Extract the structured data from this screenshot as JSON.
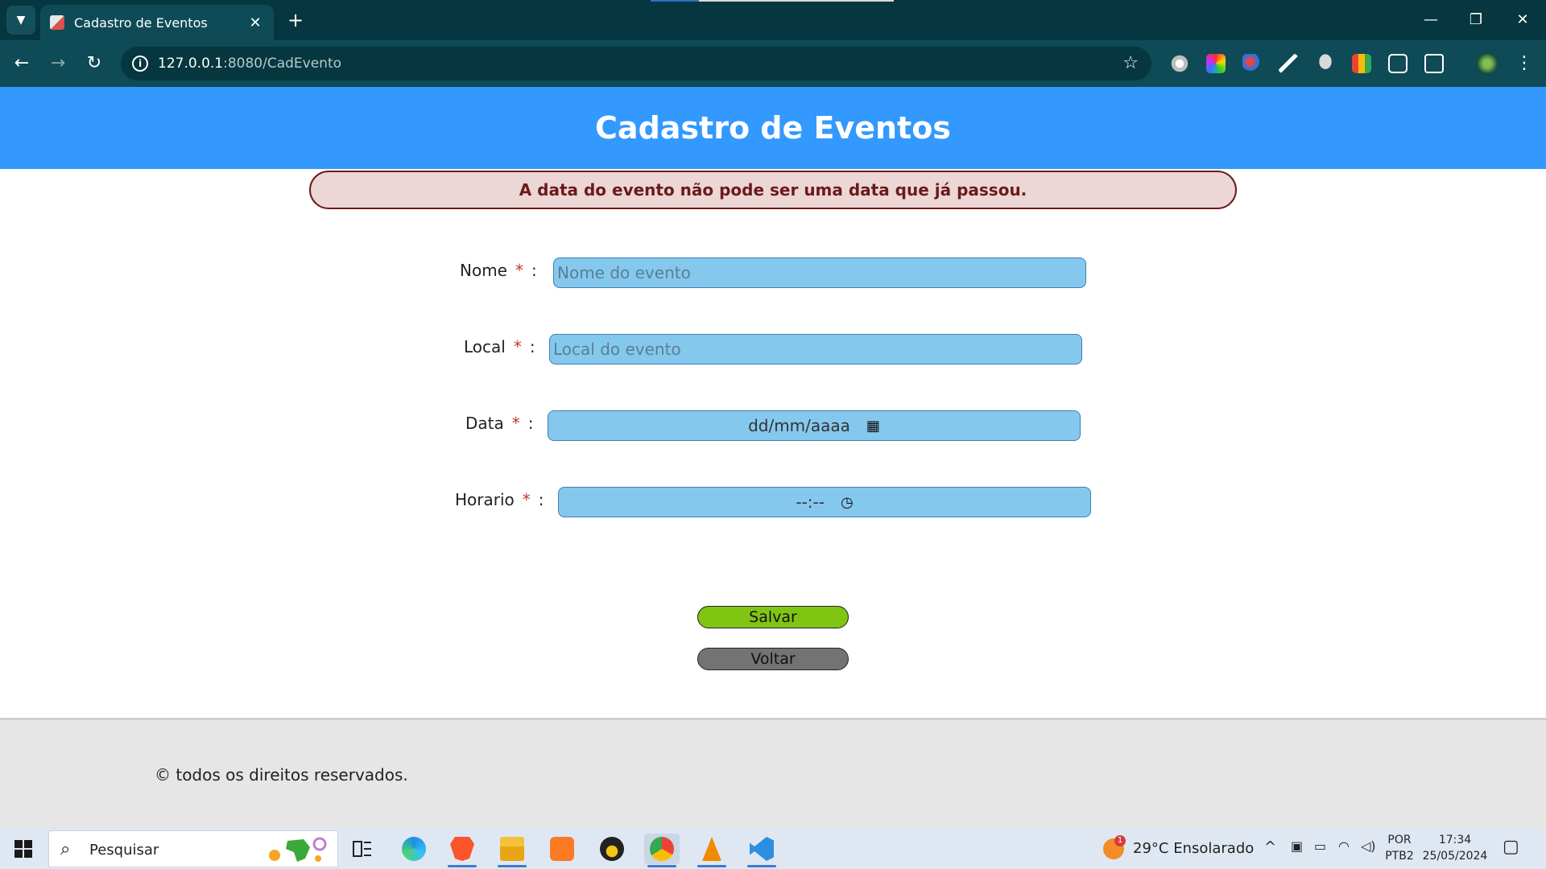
{
  "browser": {
    "tab_title": "Cadastro de Eventos",
    "tab_close": "✕",
    "new_tab": "+",
    "url_host": "127.0.0.1",
    "url_path": ":8080/CadEvento",
    "window_controls": {
      "minimize": "—",
      "restore": "❐",
      "close": "✕"
    }
  },
  "page": {
    "title": "Cadastro de Eventos",
    "alert": "A data do evento não pode ser uma data que já passou.",
    "form": {
      "nome": {
        "label": "Nome",
        "required": "*",
        "colon": ":",
        "placeholder": "Nome do evento"
      },
      "local": {
        "label": "Local",
        "required": "*",
        "colon": ":",
        "placeholder": "Local do evento"
      },
      "data": {
        "label": "Data",
        "required": "*",
        "colon": ":",
        "value": "dd/mm/aaaa"
      },
      "horario": {
        "label": "Horario",
        "required": "*",
        "colon": ":",
        "value": "--:--"
      }
    },
    "buttons": {
      "save": "Salvar",
      "back": "Voltar"
    },
    "footer": "© todos os direitos reservados."
  },
  "taskbar": {
    "search_placeholder": "Pesquisar",
    "weather_badge": "1",
    "weather": "29°C  Ensolarado",
    "lang_top": "POR",
    "lang_bottom": "PTB2",
    "time": "17:34",
    "date": "25/05/2024"
  },
  "colors": {
    "header": "#3399ff",
    "alert_bg": "#ecd6d6",
    "alert_text": "#6b1a1a",
    "input_bg": "#85c8ee",
    "save_button": "#7fc512",
    "back_button": "#737373",
    "footer_bg": "#e6e6e6"
  }
}
